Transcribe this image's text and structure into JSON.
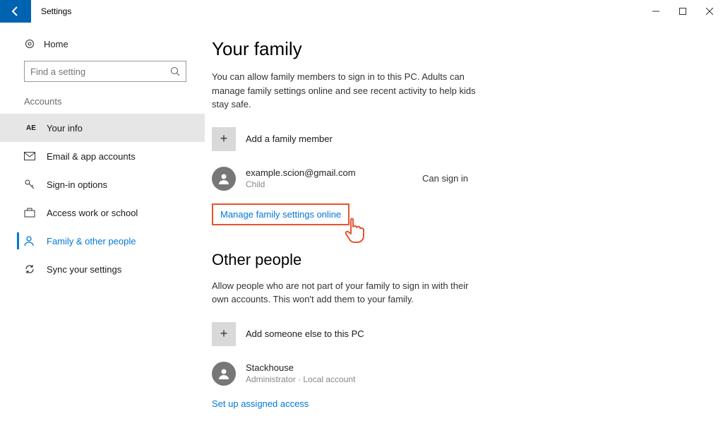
{
  "window": {
    "title": "Settings"
  },
  "sidebar": {
    "home": "Home",
    "search_placeholder": "Find a setting",
    "section": "Accounts",
    "items": [
      {
        "icon": "AE",
        "label": "Your info"
      },
      {
        "icon": "✉",
        "label": "Email & app accounts"
      },
      {
        "icon": "🔑",
        "label": "Sign-in options"
      },
      {
        "icon": "💼",
        "label": "Access work or school"
      },
      {
        "icon": "👤",
        "label": "Family & other people"
      },
      {
        "icon": "↻",
        "label": "Sync your settings"
      }
    ]
  },
  "family": {
    "heading": "Your family",
    "desc": "You can allow family members to sign in to this PC. Adults can manage family settings online and see recent activity to help kids stay safe.",
    "add_label": "Add a family member",
    "member": {
      "name": "example.scion@gmail.com",
      "role": "Child",
      "status": "Can sign in"
    },
    "manage_link": "Manage family settings online"
  },
  "other": {
    "heading": "Other people",
    "desc": "Allow people who are not part of your family to sign in with their own accounts. This won't add them to your family.",
    "add_label": "Add someone else to this PC",
    "member": {
      "name": "Stackhouse",
      "role": "Administrator · Local account"
    },
    "assigned_link": "Set up assigned access"
  },
  "colors": {
    "accent": "#0078d7",
    "highlight": "#e8522f"
  }
}
